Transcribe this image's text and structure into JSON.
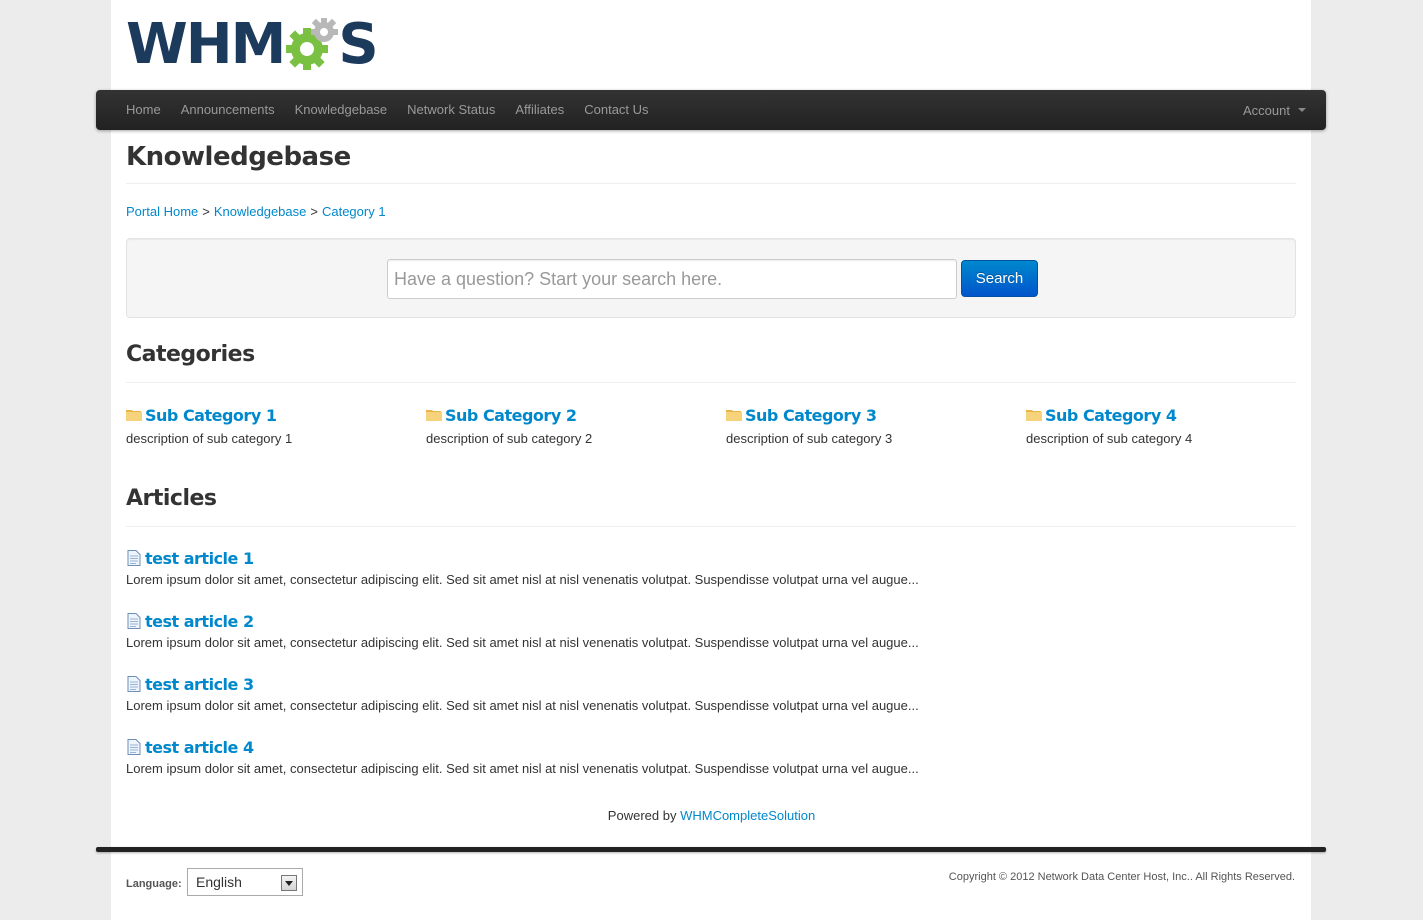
{
  "logo": {
    "text_left": "WHM",
    "text_right": "S",
    "brand_color": "#1c3a5c",
    "gear_colors": [
      "#7ac143",
      "#b8b8b8"
    ]
  },
  "nav": {
    "items": [
      {
        "label": "Home"
      },
      {
        "label": "Announcements"
      },
      {
        "label": "Knowledgebase"
      },
      {
        "label": "Network Status"
      },
      {
        "label": "Affiliates"
      },
      {
        "label": "Contact Us"
      }
    ],
    "account_label": "Account"
  },
  "page_title": "Knowledgebase",
  "breadcrumb": {
    "items": [
      {
        "label": "Portal Home"
      },
      {
        "label": "Knowledgebase"
      },
      {
        "label": "Category 1"
      }
    ],
    "separator": ">"
  },
  "search": {
    "placeholder": "Have a question? Start your search here.",
    "value": "",
    "button_label": "Search"
  },
  "categories": {
    "heading": "Categories",
    "items": [
      {
        "title": "Sub Category 1",
        "description": "description of sub category 1"
      },
      {
        "title": "Sub Category 2",
        "description": "description of sub category 2"
      },
      {
        "title": "Sub Category 3",
        "description": "description of sub category 3"
      },
      {
        "title": "Sub Category 4",
        "description": "description of sub category 4"
      }
    ]
  },
  "articles": {
    "heading": "Articles",
    "items": [
      {
        "title": "test article 1",
        "excerpt": "Lorem ipsum dolor sit amet, consectetur adipiscing elit. Sed sit amet nisl at nisl venenatis volutpat. Suspendisse volutpat urna vel augue..."
      },
      {
        "title": "test article 2",
        "excerpt": "Lorem ipsum dolor sit amet, consectetur adipiscing elit. Sed sit amet nisl at nisl venenatis volutpat. Suspendisse volutpat urna vel augue..."
      },
      {
        "title": "test article 3",
        "excerpt": "Lorem ipsum dolor sit amet, consectetur adipiscing elit. Sed sit amet nisl at nisl venenatis volutpat. Suspendisse volutpat urna vel augue..."
      },
      {
        "title": "test article 4",
        "excerpt": "Lorem ipsum dolor sit amet, consectetur adipiscing elit. Sed sit amet nisl at nisl venenatis volutpat. Suspendisse volutpat urna vel augue..."
      }
    ]
  },
  "powered_by": {
    "prefix": "Powered by",
    "link": "WHMCompleteSolution"
  },
  "footer": {
    "language_label": "Language:",
    "language_value": "English",
    "copyright": "Copyright © 2012 Network Data Center Host, Inc.. All Rights Reserved."
  },
  "colors": {
    "link": "#0088cc",
    "navbar": "#222222",
    "button": "#0066cc"
  }
}
